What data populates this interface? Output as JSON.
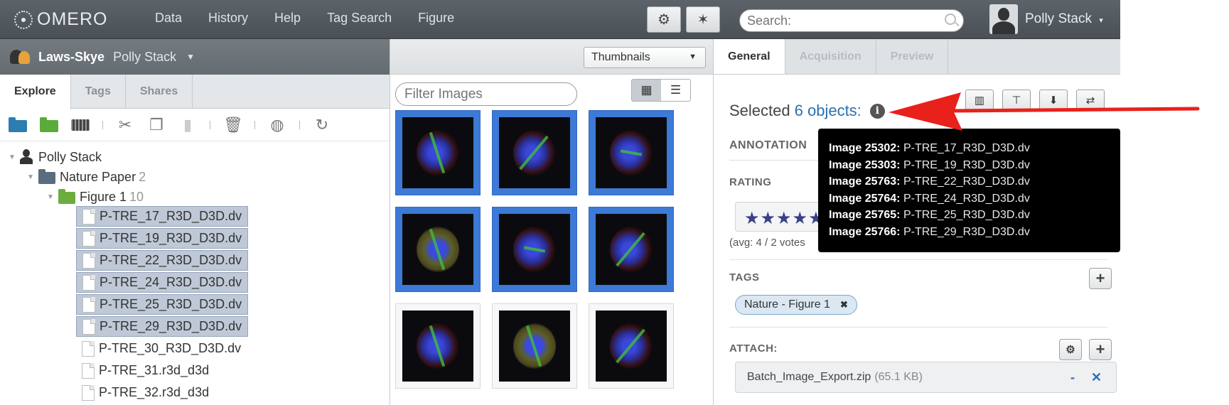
{
  "topbar": {
    "logo": "OMERO",
    "menu": [
      "Data",
      "History",
      "Help",
      "Tag Search",
      "Figure"
    ],
    "search_placeholder": "Search:",
    "user": "Polly Stack"
  },
  "left": {
    "group": "Laws-Skye",
    "group_user": "Polly Stack",
    "tabs": [
      "Explore",
      "Tags",
      "Shares"
    ],
    "tree": {
      "user": "Polly Stack",
      "project": "Nature Paper",
      "project_count": "2",
      "dataset": "Figure 1",
      "dataset_count": "10",
      "files": [
        "P-TRE_17_R3D_D3D.dv",
        "P-TRE_19_R3D_D3D.dv",
        "P-TRE_22_R3D_D3D.dv",
        "P-TRE_24_R3D_D3D.dv",
        "P-TRE_25_R3D_D3D.dv",
        "P-TRE_29_R3D_D3D.dv",
        "P-TRE_30_R3D_D3D.dv",
        "P-TRE_31.r3d_d3d",
        "P-TRE_32.r3d_d3d"
      ],
      "selected_count": 6
    }
  },
  "center": {
    "view_mode": "Thumbnails",
    "filter_placeholder": "Filter Images",
    "thumbnails_selected": 6,
    "thumbnails_total": 9
  },
  "right": {
    "tabs": [
      "General",
      "Acquisition",
      "Preview"
    ],
    "selected_prefix": "Selected",
    "selected_link": "6 objects:",
    "annotations_label": "ANNOTATION",
    "rating_label": "RATING",
    "rating_stars": "★★★★★",
    "rating_avg": "(avg: 4 / 2 votes",
    "tags_label": "TAGS",
    "tag": "Nature - Figure 1",
    "attach_label": "ATTACH:",
    "attachment_name": "Batch_Image_Export.zip",
    "attachment_size": "(65.1 KB)"
  },
  "tooltip": {
    "rows": [
      {
        "id": "Image 25302:",
        "name": "P-TRE_17_R3D_D3D.dv"
      },
      {
        "id": "Image 25303:",
        "name": "P-TRE_19_R3D_D3D.dv"
      },
      {
        "id": "Image 25763:",
        "name": "P-TRE_22_R3D_D3D.dv"
      },
      {
        "id": "Image 25764:",
        "name": "P-TRE_24_R3D_D3D.dv"
      },
      {
        "id": "Image 25765:",
        "name": "P-TRE_25_R3D_D3D.dv"
      },
      {
        "id": "Image 25766:",
        "name": "P-TRE_29_R3D_D3D.dv"
      }
    ]
  },
  "colors": {
    "topbar": "#4f565b",
    "selection": "#3d7ad6",
    "arrow": "#e8211b",
    "link": "#2b6fb5"
  }
}
